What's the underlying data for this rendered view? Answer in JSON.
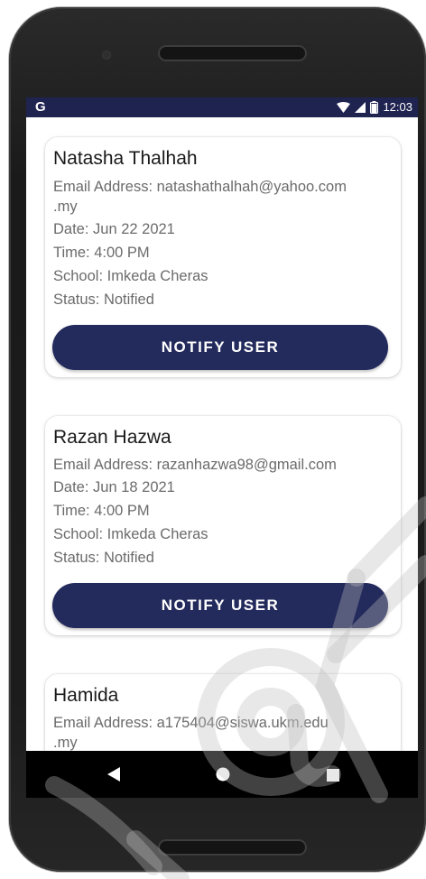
{
  "status_bar": {
    "app_icon_letter": "G",
    "time": "12:03"
  },
  "cards": [
    {
      "name": "Natasha Thalhah",
      "email_line_1": "Email Address: natashathalhah@yahoo.com",
      "email_line_2": ".my",
      "date": "Date: Jun 22 2021",
      "time": "Time: 4:00 PM",
      "school": "School: Imkeda Cheras",
      "status": "Status: Notified",
      "button_label": "NOTIFY USER"
    },
    {
      "name": "Razan Hazwa",
      "email_line_1": "Email Address: razanhazwa98@gmail.com",
      "date": "Date: Jun 18 2021",
      "time": "Time: 4:00 PM",
      "school": "School: Imkeda Cheras",
      "status": "Status: Notified",
      "button_label": "NOTIFY USER"
    },
    {
      "name": "Hamida",
      "email_line_1": "Email Address: a175404@siswa.ukm.edu",
      "email_line_2": ".my"
    }
  ],
  "colors": {
    "status_bar_bg": "#1f2350",
    "button_bg": "#232a5c",
    "nav_bar_bg": "#000000"
  },
  "icons": {
    "status": [
      "wifi-icon",
      "signal-icon",
      "battery-icon"
    ],
    "nav": [
      "back-icon",
      "home-icon",
      "recent-apps-icon"
    ]
  }
}
